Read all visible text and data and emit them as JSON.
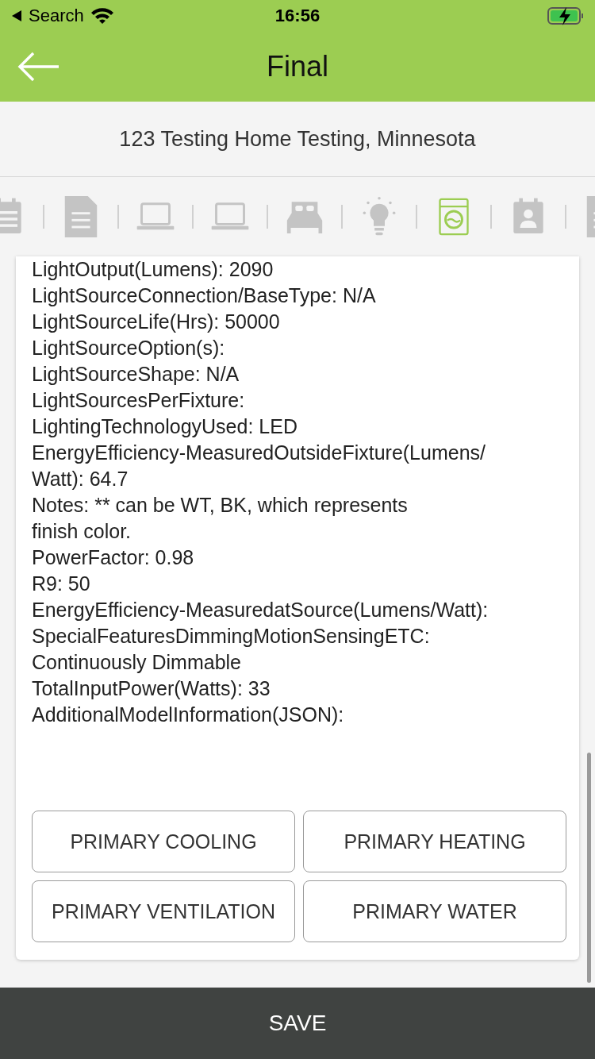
{
  "status_bar": {
    "back_label": "Search",
    "time": "16:56",
    "charging": true
  },
  "header": {
    "title": "Final"
  },
  "address": "123 Testing Home Testing, Minnesota",
  "category_tabs": [
    {
      "kind": "calendar-list",
      "selected": false
    },
    {
      "kind": "document",
      "selected": false
    },
    {
      "kind": "laptop",
      "selected": false
    },
    {
      "kind": "laptop",
      "selected": false
    },
    {
      "kind": "bed",
      "selected": false
    },
    {
      "kind": "lightbulb",
      "selected": false
    },
    {
      "kind": "washer",
      "selected": true
    },
    {
      "kind": "calendar-person",
      "selected": false
    },
    {
      "kind": "document",
      "selected": false
    }
  ],
  "details": [
    "LightOutput(Lumens): 2090",
    "LightSourceConnection/BaseType: N/A",
    "LightSourceLife(Hrs): 50000",
    "LightSourceOption(s):",
    "LightSourceShape: N/A",
    "LightSourcesPerFixture:",
    "LightingTechnologyUsed: LED",
    "EnergyEfficiency-MeasuredOutsideFixture(Lumens/",
    "Watt): 64.7",
    "Notes: ** can be WT,  BK, which represents",
    "finish color.",
    "PowerFactor: 0.98",
    "R9: 50",
    "EnergyEfficiency-MeasuredatSource(Lumens/Watt):",
    "SpecialFeaturesDimmingMotionSensingETC:",
    "Continuously Dimmable",
    "TotalInputPower(Watts): 33",
    "AdditionalModelInformation(JSON):"
  ],
  "actions": [
    "PRIMARY COOLING",
    "PRIMARY HEATING",
    "PRIMARY VENTILATION",
    "PRIMARY WATER"
  ],
  "save_button": "SAVE"
}
